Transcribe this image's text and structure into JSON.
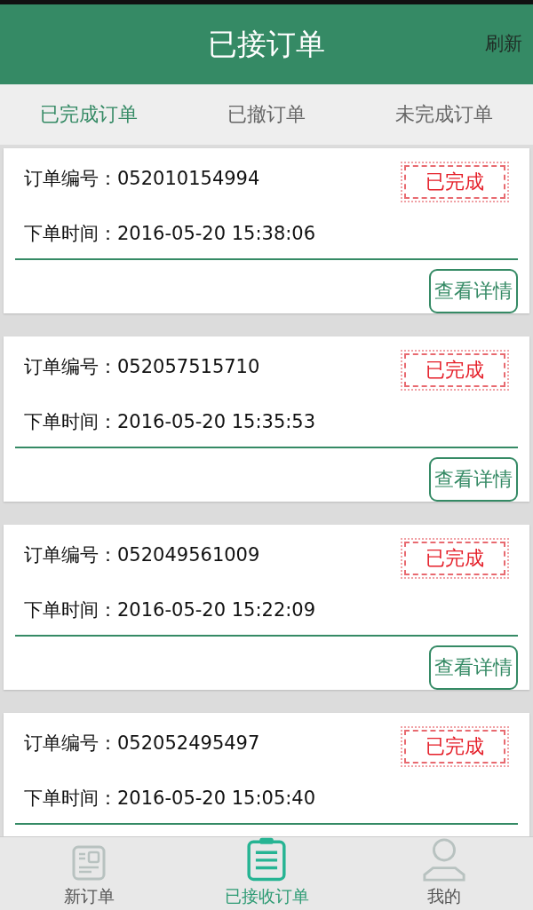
{
  "header": {
    "title": "已接订单",
    "action": "刷新"
  },
  "tabs": [
    {
      "label": "已完成订单",
      "selected": true
    },
    {
      "label": "已撤订单",
      "selected": false
    },
    {
      "label": "未完成订单",
      "selected": false
    }
  ],
  "orders": [
    {
      "number_label": "订单编号：",
      "number": "052010154994",
      "time_label": "下单时间：",
      "time": "2016-05-20 15:38:06",
      "status": "已完成",
      "button": "查看详情"
    },
    {
      "number_label": "订单编号：",
      "number": "052057515710",
      "time_label": "下单时间：",
      "time": "2016-05-20 15:35:53",
      "status": "已完成",
      "button": "查看详情"
    },
    {
      "number_label": "订单编号：",
      "number": "052049561009",
      "time_label": "下单时间：",
      "time": "2016-05-20 15:22:09",
      "status": "已完成",
      "button": "查看详情"
    },
    {
      "number_label": "订单编号：",
      "number": "052052495497",
      "time_label": "下单时间：",
      "time": "2016-05-20 15:05:40",
      "status": "已完成"
    }
  ],
  "bottom_nav": [
    {
      "kind": "form",
      "label": "新订单",
      "selected": false
    },
    {
      "kind": "clipboard",
      "label": "已接收订单",
      "selected": true
    },
    {
      "kind": "person",
      "label": "我的",
      "selected": false
    }
  ]
}
